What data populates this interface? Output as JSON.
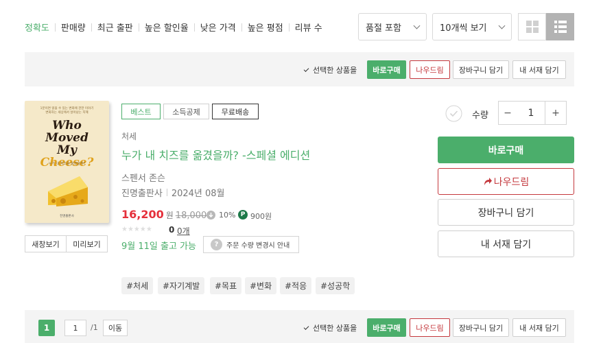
{
  "sort_options": [
    {
      "label": "정확도",
      "active": true
    },
    {
      "label": "판매량",
      "active": false
    },
    {
      "label": "최근 출판",
      "active": false
    },
    {
      "label": "높은 할인율",
      "active": false
    },
    {
      "label": "낮은 가격",
      "active": false
    },
    {
      "label": "높은 평점",
      "active": false
    },
    {
      "label": "리뷰 수",
      "active": false
    }
  ],
  "filters": {
    "stock_select": "품절 포함",
    "per_page_select": "10개씩 보기"
  },
  "action_bar": {
    "selected_label": "선택한 상품을",
    "buy_now": "바로구매",
    "gift": "나우드림",
    "cart": "장바구니 담기",
    "library": "내 서재 담기"
  },
  "book": {
    "cover_text": {
      "top_line1": "1분이면 읽을 수 있는 변화에 관한 이야기",
      "top_line2": "변화하는 세상에서 살아남는 지혜",
      "title_l1": "Who",
      "title_l2": "Moved",
      "title_l3a": "My",
      "title_l3b": "Cheese?",
      "subtitle": "누가 내 치즈를 옮겼을까?",
      "publisher": "진명출판사"
    },
    "new_window": "새창보기",
    "preview": "미리보기",
    "tags": [
      "베스트",
      "소득공제",
      "무료배송"
    ],
    "category": "처세",
    "title": "누가 내 치즈를 옮겼을까? -스페셜 에디션",
    "author": "스펜서 존슨",
    "publisher": "진명출판사",
    "pub_date": "2024년 08월",
    "price": "16,200",
    "price_unit": "원",
    "original_price": "18,000",
    "discount": "10%",
    "points_badge": "P",
    "points": "900원",
    "rating_stars": 0,
    "rating_score": "0",
    "review_count": "0개",
    "delivery": "9월 11일 출고 가능",
    "order_notice": "주문 수량 변경시 안내",
    "help_icon": "?",
    "hashtags": [
      "#처세",
      "#자기계발",
      "#목표",
      "#변화",
      "#적응",
      "#성공학"
    ]
  },
  "quantity": {
    "label": "수량",
    "value": "1",
    "minus": "−",
    "plus": "+"
  },
  "side_buttons": {
    "buy_now": "바로구매",
    "gift": "나우드림",
    "cart": "장바구니 담기",
    "library": "내 서재 담기"
  },
  "pagination": {
    "current_page": "1",
    "input_value": "1",
    "total": "/1",
    "go": "이동"
  },
  "colors": {
    "accent_green": "#4bae6b",
    "accent_red": "#c4373c",
    "bar_bg": "#f4f4f4"
  }
}
